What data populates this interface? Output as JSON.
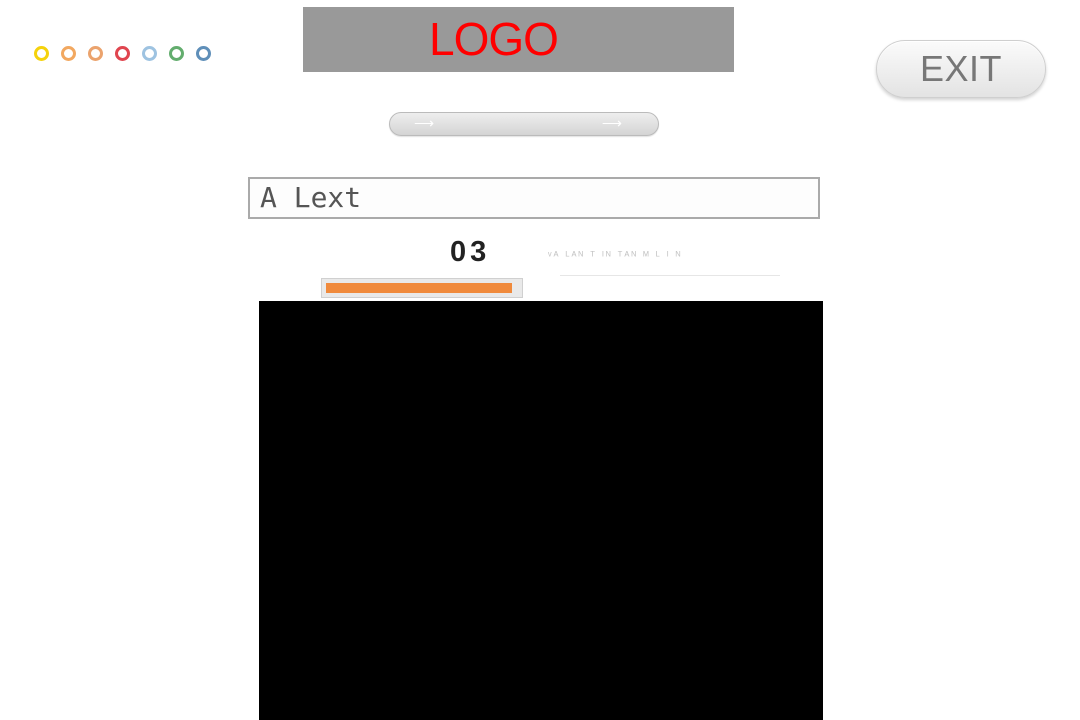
{
  "progress_dots": [
    {
      "color": "#f5d20c"
    },
    {
      "color": "#f2a860"
    },
    {
      "color": "#eba36d"
    },
    {
      "color": "#e0454f"
    },
    {
      "color": "#9ec3e1"
    },
    {
      "color": "#63ad6e"
    },
    {
      "color": "#5f8fb9"
    }
  ],
  "logo": {
    "text": "LOGO",
    "text_color": "#ff0000",
    "background": "#999999"
  },
  "exit_button": {
    "label": "EXIT"
  },
  "slider": {
    "left_arrow": "⟶",
    "right_arrow": "⟶"
  },
  "text_field": {
    "value": "A Lext"
  },
  "counter": {
    "value": "03"
  },
  "progress": {
    "fraction": 0.97,
    "color": "#f08a3c"
  },
  "media_area": {
    "background": "#000000"
  }
}
